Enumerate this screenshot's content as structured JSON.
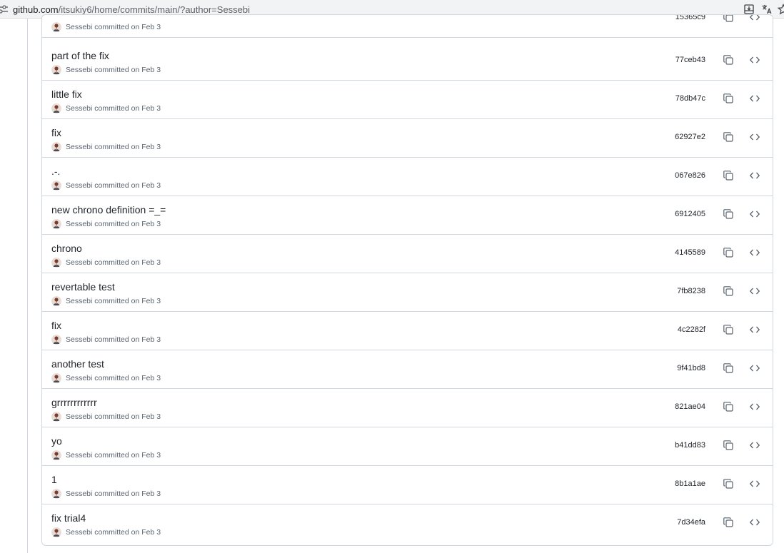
{
  "browser": {
    "url_host": "github.com",
    "url_path": "/itsukiy6/home/commits/main/?author=Sessebi"
  },
  "commits": [
    {
      "message": "",
      "meta": "Sessebi committed on Feb 3",
      "sha": "15365c9"
    },
    {
      "message": "part of the fix",
      "meta": "Sessebi committed on Feb 3",
      "sha": "77ceb43"
    },
    {
      "message": "little fix",
      "meta": "Sessebi committed on Feb 3",
      "sha": "78db47c"
    },
    {
      "message": "fix",
      "meta": "Sessebi committed on Feb 3",
      "sha": "62927e2"
    },
    {
      "message": ".-.",
      "meta": "Sessebi committed on Feb 3",
      "sha": "067e826"
    },
    {
      "message": "new chrono definition =_=",
      "meta": "Sessebi committed on Feb 3",
      "sha": "6912405"
    },
    {
      "message": "chrono",
      "meta": "Sessebi committed on Feb 3",
      "sha": "4145589"
    },
    {
      "message": "revertable test",
      "meta": "Sessebi committed on Feb 3",
      "sha": "7fb8238"
    },
    {
      "message": "fix",
      "meta": "Sessebi committed on Feb 3",
      "sha": "4c2282f"
    },
    {
      "message": "another test",
      "meta": "Sessebi committed on Feb 3",
      "sha": "9f41bd8"
    },
    {
      "message": "grrrrrrrrrrrr",
      "meta": "Sessebi committed on Feb 3",
      "sha": "821ae04"
    },
    {
      "message": "yo",
      "meta": "Sessebi committed on Feb 3",
      "sha": "b41dd83"
    },
    {
      "message": "1",
      "meta": "Sessebi committed on Feb 3",
      "sha": "8b1a1ae"
    },
    {
      "message": "fix trial4",
      "meta": "Sessebi committed on Feb 3",
      "sha": "7d34efa"
    }
  ]
}
